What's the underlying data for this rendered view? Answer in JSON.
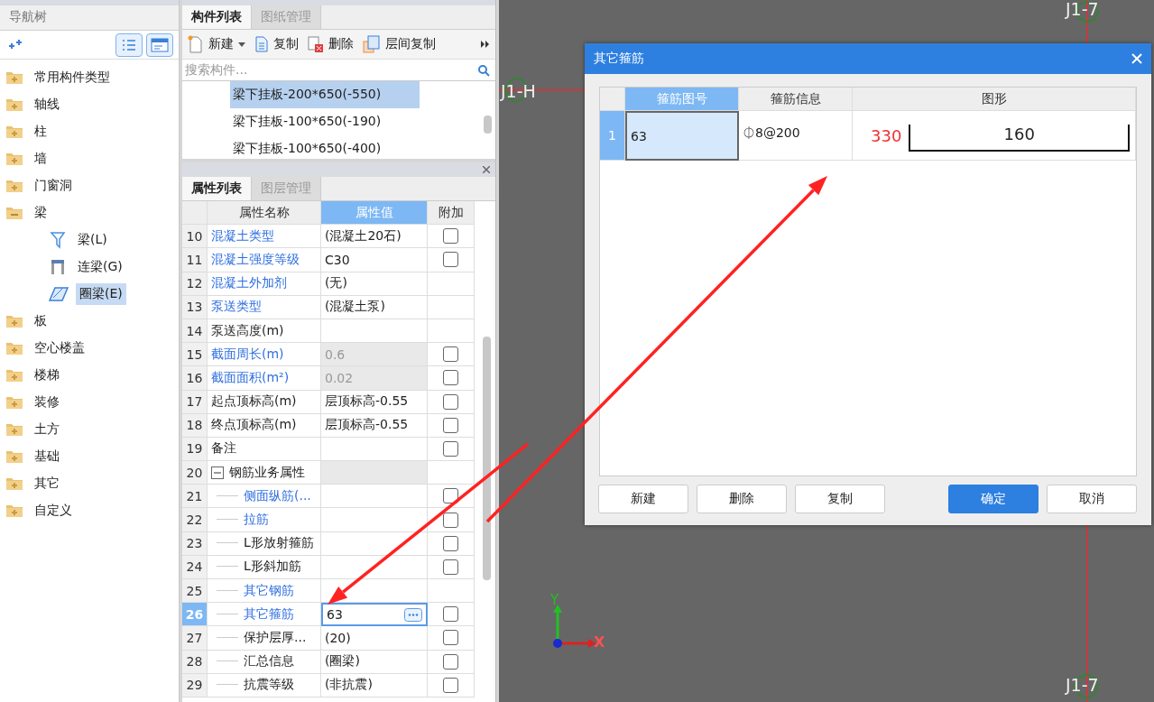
{
  "nav": {
    "title": "导航树",
    "items": [
      {
        "label": "常用构件类型",
        "expanded": false
      },
      {
        "label": "轴线",
        "expanded": false
      },
      {
        "label": "柱",
        "expanded": false
      },
      {
        "label": "墙",
        "expanded": false
      },
      {
        "label": "门窗洞",
        "expanded": false
      },
      {
        "label": "梁",
        "expanded": true,
        "children": [
          {
            "label": "梁(L)",
            "kind": "beam",
            "selected": false
          },
          {
            "label": "连梁(G)",
            "kind": "coupling",
            "selected": false
          },
          {
            "label": "圈梁(E)",
            "kind": "ring",
            "selected": true
          }
        ]
      },
      {
        "label": "板",
        "expanded": false
      },
      {
        "label": "空心楼盖",
        "expanded": false
      },
      {
        "label": "楼梯",
        "expanded": false
      },
      {
        "label": "装修",
        "expanded": false
      },
      {
        "label": "土方",
        "expanded": false
      },
      {
        "label": "基础",
        "expanded": false
      },
      {
        "label": "其它",
        "expanded": false
      },
      {
        "label": "自定义",
        "expanded": false
      }
    ]
  },
  "component_panel": {
    "tabs": [
      {
        "label": "构件列表",
        "selected": true
      },
      {
        "label": "图纸管理",
        "selected": false
      }
    ],
    "toolbar": [
      {
        "label": "新建",
        "kind": "new",
        "dropdown": true
      },
      {
        "label": "复制",
        "kind": "copy",
        "dropdown": false
      },
      {
        "label": "删除",
        "kind": "delete",
        "dropdown": false
      },
      {
        "label": "层间复制",
        "kind": "floor-copy",
        "dropdown": false
      }
    ],
    "search": {
      "placeholder": "搜索构件..."
    },
    "items": [
      {
        "label": "梁下挂板-200*650(-550)",
        "selected": true
      },
      {
        "label": "梁下挂板-100*650(-190)",
        "selected": false
      },
      {
        "label": "梁下挂板-100*650(-400)",
        "selected": false
      }
    ]
  },
  "property_panel": {
    "tabs": [
      {
        "label": "属性列表",
        "selected": true
      },
      {
        "label": "图层管理",
        "selected": false
      }
    ],
    "columns": [
      {
        "label": "属性名称",
        "selected": false
      },
      {
        "label": "属性值",
        "selected": true
      },
      {
        "label": "附加",
        "selected": false
      }
    ],
    "rows": [
      {
        "index": "10",
        "name": "混凝土类型",
        "linked": true,
        "value": "(混凝土20石)",
        "readonly": false,
        "selected": false,
        "checked": false
      },
      {
        "index": "11",
        "name": "混凝土强度等级",
        "linked": true,
        "value": "C30",
        "readonly": false,
        "selected": false,
        "checked": false
      },
      {
        "index": "12",
        "name": "混凝土外加剂",
        "linked": true,
        "value": "(无)",
        "readonly": false,
        "selected": false
      },
      {
        "index": "13",
        "name": "泵送类型",
        "linked": true,
        "value": "(混凝土泵)",
        "readonly": false,
        "selected": false
      },
      {
        "index": "14",
        "name": "泵送高度(m)",
        "linked": false,
        "readonly": false,
        "selected": false
      },
      {
        "index": "15",
        "name": "截面周长(m)",
        "linked": true,
        "value": "0.6",
        "readonly": true,
        "selected": false,
        "checked": false
      },
      {
        "index": "16",
        "name": "截面面积(m²)",
        "linked": true,
        "value": "0.02",
        "readonly": true,
        "selected": false,
        "checked": false
      },
      {
        "index": "17",
        "name": "起点顶标高(m)",
        "linked": false,
        "value": "层顶标高-0.55",
        "readonly": false,
        "selected": false,
        "checked": false
      },
      {
        "index": "18",
        "name": "终点顶标高(m)",
        "linked": false,
        "value": "层顶标高-0.55",
        "readonly": false,
        "selected": false,
        "checked": false
      },
      {
        "index": "19",
        "name": "备注",
        "linked": false,
        "readonly": false,
        "selected": false,
        "checked": false
      },
      {
        "index": "20",
        "name": "钢筋业务属性",
        "linked": false,
        "readonly": true,
        "selected": false,
        "expanded": true,
        "children": [
          {
            "index": "21",
            "name": "侧面纵筋(...",
            "linked": true,
            "readonly": false,
            "selected": false,
            "checked": false
          },
          {
            "index": "22",
            "name": "拉筋",
            "linked": true,
            "readonly": false,
            "selected": false,
            "checked": false
          },
          {
            "index": "23",
            "name": "L形放射箍筋",
            "linked": false,
            "readonly": false,
            "selected": false,
            "checked": false
          },
          {
            "index": "24",
            "name": "L形斜加筋",
            "linked": false,
            "readonly": false,
            "selected": false,
            "checked": false
          },
          {
            "index": "25",
            "name": "其它钢筋",
            "linked": true,
            "readonly": false,
            "selected": false
          },
          {
            "index": "26",
            "name": "其它箍筋",
            "linked": true,
            "value": "63",
            "readonly": false,
            "selected": true,
            "checked": false
          },
          {
            "index": "27",
            "name": "保护层厚...",
            "linked": false,
            "value": "(20)",
            "readonly": false,
            "selected": false,
            "checked": false
          },
          {
            "index": "28",
            "name": "汇总信息",
            "linked": false,
            "value": "(圈梁)",
            "readonly": false,
            "selected": false,
            "checked": false
          },
          {
            "index": "29",
            "name": "抗震等级",
            "linked": false,
            "value": "(非抗震)",
            "readonly": false,
            "selected": false,
            "checked": false
          }
        ]
      }
    ]
  },
  "canvas": {
    "axis_labels": [
      {
        "label": "J1-H",
        "kind": "horizontal"
      },
      {
        "label": "J1-7",
        "kind": "top"
      },
      {
        "label": "J1-7",
        "kind": "bottom"
      }
    ],
    "axes": {
      "y": "Y",
      "x": "X"
    }
  },
  "dialog": {
    "title": "其它箍筋",
    "columns": [
      {
        "label": "箍筋图号",
        "selected": true
      },
      {
        "label": "箍筋信息",
        "selected": false
      },
      {
        "label": "图形",
        "selected": false
      }
    ],
    "rows": [
      {
        "index": "1",
        "selected": true,
        "figure_no": "63",
        "info": "⏀8@200",
        "shape": {
          "side": "330",
          "length": "160"
        }
      }
    ],
    "buttons": [
      {
        "label": "新建",
        "primary": false
      },
      {
        "label": "删除",
        "primary": false
      },
      {
        "label": "复制",
        "primary": false
      },
      {
        "label": "确定",
        "primary": true
      },
      {
        "label": "取消",
        "primary": false
      }
    ]
  }
}
